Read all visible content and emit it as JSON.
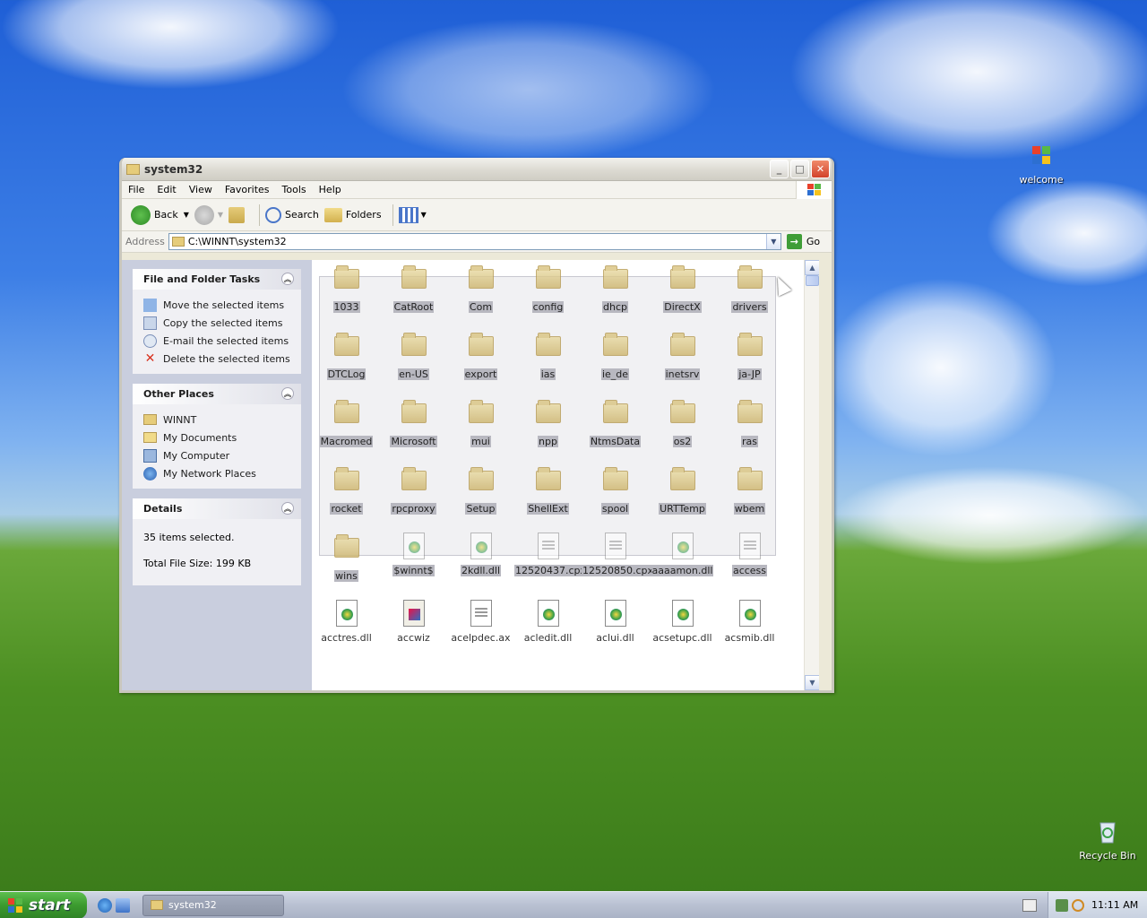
{
  "desktop": {
    "icons": [
      {
        "label": "welcome"
      },
      {
        "label": "Recycle Bin"
      }
    ]
  },
  "window": {
    "title": "system32",
    "menu": [
      "File",
      "Edit",
      "View",
      "Favorites",
      "Tools",
      "Help"
    ],
    "toolbar": {
      "back": "Back",
      "search": "Search",
      "folders": "Folders"
    },
    "address": {
      "label": "Address",
      "value": "C:\\WINNT\\system32",
      "go": "Go"
    },
    "taskpane": {
      "file_tasks": {
        "title": "File and Folder Tasks",
        "items": [
          "Move the selected items",
          "Copy the selected items",
          "E-mail the selected items",
          "Delete the selected items"
        ]
      },
      "other_places": {
        "title": "Other Places",
        "items": [
          "WINNT",
          "My Documents",
          "My Computer",
          "My Network Places"
        ]
      },
      "details": {
        "title": "Details",
        "selected": "35 items selected.",
        "size": "Total File Size: 199 KB"
      }
    },
    "items": [
      {
        "name": "1033",
        "kind": "folder",
        "selected": true
      },
      {
        "name": "CatRoot",
        "kind": "folder",
        "selected": true
      },
      {
        "name": "Com",
        "kind": "folder",
        "selected": true
      },
      {
        "name": "config",
        "kind": "folder",
        "selected": true
      },
      {
        "name": "dhcp",
        "kind": "folder",
        "selected": true
      },
      {
        "name": "DirectX",
        "kind": "folder",
        "selected": true
      },
      {
        "name": "drivers",
        "kind": "folder",
        "selected": true
      },
      {
        "name": "DTCLog",
        "kind": "folder",
        "selected": true
      },
      {
        "name": "en-US",
        "kind": "folder",
        "selected": true
      },
      {
        "name": "export",
        "kind": "folder",
        "selected": true
      },
      {
        "name": "ias",
        "kind": "folder",
        "selected": true
      },
      {
        "name": "ie_de",
        "kind": "folder",
        "selected": true
      },
      {
        "name": "inetsrv",
        "kind": "folder",
        "selected": true
      },
      {
        "name": "ja-JP",
        "kind": "folder",
        "selected": true
      },
      {
        "name": "Macromed",
        "kind": "folder",
        "selected": true
      },
      {
        "name": "Microsoft",
        "kind": "folder",
        "selected": true
      },
      {
        "name": "mui",
        "kind": "folder",
        "selected": true
      },
      {
        "name": "npp",
        "kind": "folder",
        "selected": true
      },
      {
        "name": "NtmsData",
        "kind": "folder",
        "selected": true
      },
      {
        "name": "os2",
        "kind": "folder",
        "selected": true
      },
      {
        "name": "ras",
        "kind": "folder",
        "selected": true
      },
      {
        "name": "rocket",
        "kind": "folder",
        "selected": true
      },
      {
        "name": "rpcproxy",
        "kind": "folder",
        "selected": true
      },
      {
        "name": "Setup",
        "kind": "folder",
        "selected": true
      },
      {
        "name": "ShellExt",
        "kind": "folder",
        "selected": true
      },
      {
        "name": "spool",
        "kind": "folder",
        "selected": true
      },
      {
        "name": "URTTemp",
        "kind": "folder",
        "selected": true
      },
      {
        "name": "wbem",
        "kind": "folder",
        "selected": true
      },
      {
        "name": "wins",
        "kind": "folder",
        "selected": true
      },
      {
        "name": "$winnt$",
        "kind": "file",
        "selected": true
      },
      {
        "name": "2kdll.dll",
        "kind": "dll",
        "selected": true
      },
      {
        "name": "12520437.cpx",
        "kind": "gen",
        "selected": true
      },
      {
        "name": "12520850.cpx",
        "kind": "gen",
        "selected": true
      },
      {
        "name": "aaaamon.dll",
        "kind": "dll",
        "selected": true
      },
      {
        "name": "access",
        "kind": "gen",
        "selected": true
      },
      {
        "name": "acctres.dll",
        "kind": "dll",
        "selected": false
      },
      {
        "name": "accwiz",
        "kind": "wiz",
        "selected": false
      },
      {
        "name": "acelpdec.ax",
        "kind": "gen",
        "selected": false
      },
      {
        "name": "acledit.dll",
        "kind": "dll",
        "selected": false
      },
      {
        "name": "aclui.dll",
        "kind": "dll",
        "selected": false
      },
      {
        "name": "acsetupc.dll",
        "kind": "dll",
        "selected": false
      },
      {
        "name": "acsmib.dll",
        "kind": "dll",
        "selected": false
      }
    ]
  },
  "taskbar": {
    "start": "start",
    "task": "system32",
    "clock": "11:11 AM"
  }
}
